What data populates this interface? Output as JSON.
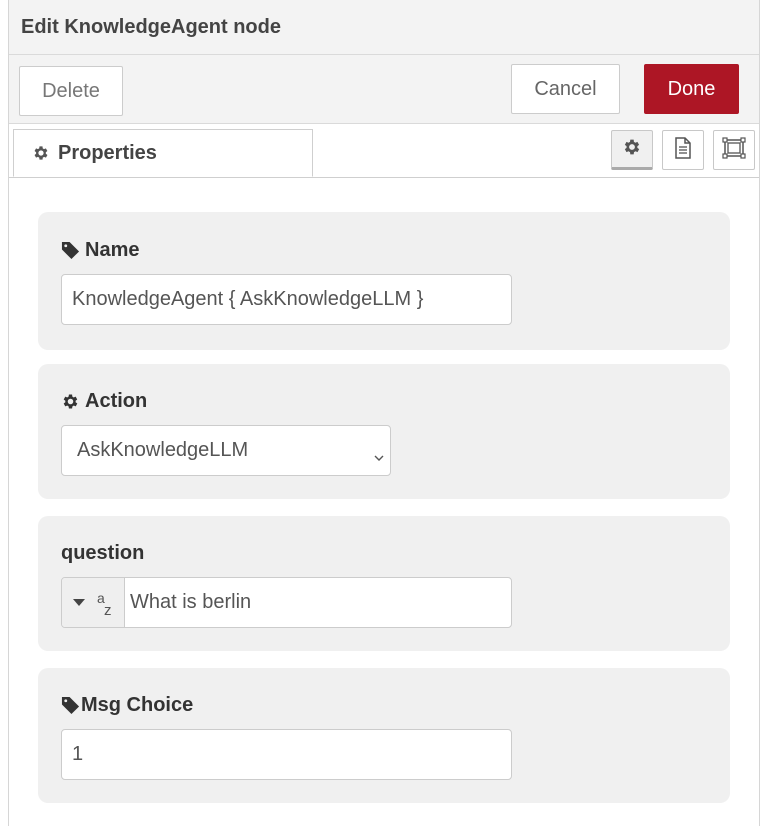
{
  "tray": {
    "title": "Edit KnowledgeAgent node",
    "buttons": {
      "delete": "Delete",
      "cancel": "Cancel",
      "done": "Done"
    }
  },
  "tabs": [
    {
      "label": "Properties",
      "icon": "gear-icon",
      "active": true
    }
  ],
  "tab_icons": [
    "gear-icon",
    "document-icon",
    "node-appearance-icon"
  ],
  "form": {
    "name": {
      "label": "Name",
      "icon": "tag-icon",
      "value": "KnowledgeAgent { AskKnowledgeLLM }"
    },
    "action": {
      "label": "Action",
      "icon": "gear-icon",
      "value": "AskKnowledgeLLM"
    },
    "question": {
      "label": "question",
      "type_label_a": "a",
      "type_label_z": "z",
      "value": "What is berlin"
    },
    "msg_choice": {
      "label": "Msg Choice",
      "icon": "tag-icon",
      "value": "1"
    }
  },
  "colors": {
    "done_button": "#ad1625",
    "panel_bg": "#f0f0f0",
    "header_bg": "#f3f3f3"
  }
}
